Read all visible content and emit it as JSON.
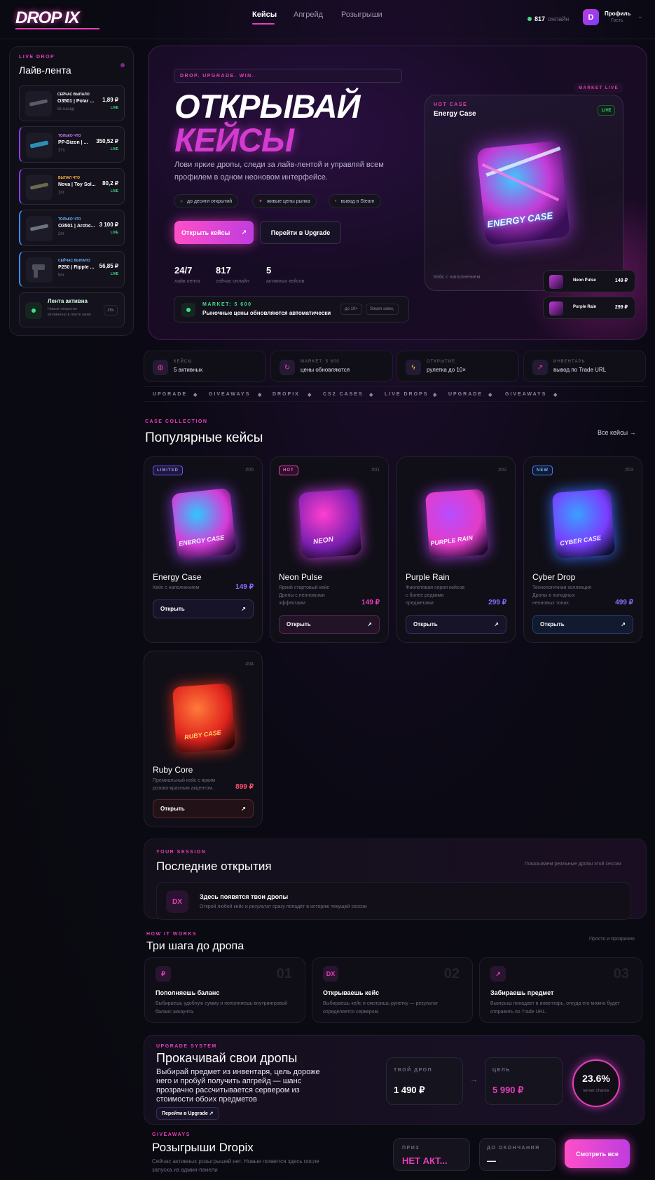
{
  "header": {
    "logo": "DROP IX",
    "nav": [
      "Кейсы",
      "Апгрейд",
      "Розыгрыши"
    ],
    "online_count": "817",
    "online_label": "онлайн",
    "avatar_letter": "D",
    "profile_name": "Профиль",
    "profile_role": "Гость"
  },
  "sidebar": {
    "kicker": "LIVE DROP",
    "title": "Лайв-лента",
    "items": [
      {
        "tag": "СЕЙЧАС ВЫПАЛО",
        "name": "Ο3501 | Polar ...",
        "time": "8s назад",
        "price": "1,89 ₽",
        "live": "LIVE",
        "tag_color": "#ffffff"
      },
      {
        "tag": "ТОЛЬКО ЧТО",
        "name": "PP-Bizon | ...",
        "time": "37s",
        "price": "350,52 ₽",
        "live": "LIVE",
        "tag_color": "#c77dff"
      },
      {
        "tag": "ВЫПАЛ ЧТО",
        "name": "Nova | Toy Sol...",
        "time": "1m",
        "price": "80,2 ₽",
        "live": "LIVE",
        "tag_color": "#ffb347"
      },
      {
        "tag": "ТОЛЬКО ЧТО",
        "name": "Ο3501 | Arctic...",
        "time": "2m",
        "price": "3 100 ₽",
        "live": "LIVE",
        "tag_color": "#6ab8ff"
      },
      {
        "tag": "СЕЙЧАС ВЫПАЛО",
        "name": "P250 | Ripple ...",
        "time": "5m",
        "price": "56,85 ₽",
        "live": "LIVE",
        "tag_color": "#6ab8ff"
      }
    ],
    "active": {
      "title": "Лента активна",
      "desc": "Новые открытия мгновенно в ленте ниже",
      "badge": "15s"
    }
  },
  "hero": {
    "tag": "DROP. UPGRADE. WIN.",
    "title1": "ОТКРЫВАЙ",
    "title2": "КЕЙСЫ",
    "desc": "Лови яркие дропы, следи за лайв-лентой и управляй всем профилем в одном неоновом интерфейсе.",
    "chips": [
      "до десяти открытий",
      "живые цены рынка",
      "вывод в Steam"
    ],
    "btn_primary": "Открыть кейсы",
    "btn_secondary": "Перейти в Upgrade",
    "stats": [
      {
        "value": "24/7",
        "label": "лайв лента"
      },
      {
        "value": "817",
        "label": "сейчас онлайн"
      },
      {
        "value": "5",
        "label": "активных кейсов"
      }
    ],
    "market": {
      "kicker": "MARKET: 5 600",
      "text": "Рыночные цены обновляются автоматически",
      "chip1": "до 10×",
      "chip2": "Steam sales,"
    },
    "market_live": "MARKET LIVE",
    "hot": {
      "kicker": "HOT CASE",
      "name": "Energy Case",
      "badge": "LIVE",
      "art": "ENERGY CASE",
      "caption": "Кейс с наполнением"
    },
    "mini": [
      {
        "name": "Neon Pulse",
        "price": "149 ₽"
      },
      {
        "name": "Purple Rain",
        "price": "299 ₽"
      }
    ]
  },
  "features": [
    {
      "icon": "case-icon",
      "kicker": "КЕЙСЫ",
      "text": "5 активных"
    },
    {
      "icon": "refresh-icon",
      "kicker": "MARKET: 5 600",
      "text": "цены обновляются"
    },
    {
      "icon": "bolt-icon",
      "kicker": "ОТКРЫТИЕ",
      "text": "рулетка до 10×"
    },
    {
      "icon": "arrow-icon",
      "kicker": "ИНВЕНТАРЬ",
      "text": "вывод по Trade URL"
    }
  ],
  "marquee": [
    "UPGRADE",
    "GIVEAWAYS",
    "DROPIX",
    "CS2 CASES",
    "LIVE DROPS",
    "UPGRADE",
    "GIVEAWAYS"
  ],
  "collection": {
    "kicker": "CASE COLLECTION",
    "title": "Популярные кейсы",
    "all_link": "Все кейсы",
    "cases": [
      {
        "badge": "LIMITED",
        "num": "#05",
        "name": "Energy Case",
        "desc": "Кейс с наполнением",
        "price": "149 ₽",
        "open": "Открыть",
        "art": "ENERGY CASE",
        "c1": "#2ec8ff",
        "c2": "#d63bd8"
      },
      {
        "badge": "HOT",
        "num": "#01",
        "name": "Neon Pulse",
        "desc": "Яркий стартовый кейс Дропы с неоновыми эффектами",
        "price": "149 ₽",
        "open": "Открыть",
        "art": "NEON",
        "c1": "#ff3fd0",
        "c2": "#7a1fb0"
      },
      {
        "badge": "",
        "num": "#02",
        "name": "Purple Rain",
        "desc": "Фиолетовая серия кейсов с более редкими предметами",
        "price": "299 ₽",
        "open": "Открыть",
        "art": "PURPLE RAIN",
        "c1": "#b84dff",
        "c2": "#e23bc8"
      },
      {
        "badge": "NEW",
        "num": "#03",
        "name": "Cyber Drop",
        "desc": "Технологичная коллекция Дропы в холодных неоновых тонах.",
        "price": "499 ₽",
        "open": "Открыть",
        "art": "CYBER CASE",
        "c1": "#3aa0ff",
        "c2": "#7a3dff"
      },
      {
        "badge": "",
        "num": "#04",
        "name": "Ruby Core",
        "desc": "Премиальный кейс с ярким розово-красным акцентом.",
        "price": "899 ₽",
        "open": "Открыть",
        "art": "RUBY CASE",
        "c1": "#ff3a2a",
        "c2": "#ffb03a"
      }
    ]
  },
  "session": {
    "kicker": "YOUR SESSION",
    "title": "Последние открытия",
    "note": "Показываем реальные дропы этой сессии",
    "icon": "DX",
    "empty_title": "Здесь появятся твои дропы",
    "empty_desc": "Открой любой кейс и результат сразу попадёт в историю текущей сессии"
  },
  "how": {
    "kicker": "HOW IT WORKS",
    "title": "Три шага до дропа",
    "note": "Просто и прозрачно",
    "steps": [
      {
        "icon": "₽",
        "num": "01",
        "title": "Пополняешь баланс",
        "desc": "Выбираешь удобную сумму и пополняешь внутриигровой баланс аккаунта."
      },
      {
        "icon": "DX",
        "num": "02",
        "title": "Открываешь кейс",
        "desc": "Выбираешь кейс и смотришь рулетку — результат определяется сервером."
      },
      {
        "icon": "↗",
        "num": "03",
        "title": "Забираешь предмет",
        "desc": "Выигрыш попадает в инвентарь, откуда его можно будет отправить по Trade URL."
      }
    ]
  },
  "upgrade": {
    "kicker": "UPGRADE SYSTEM",
    "title": "Прокачивай свои дропы",
    "desc": "Выбирай предмет из инвентаря, цель дороже него и пробуй получить апгрейд — шанс прозрачно рассчитывается сервером из стоимости обоих предметов",
    "btn": "Перейти в Upgrade ↗",
    "your_label": "ТВОЙ ДРОП",
    "your_value": "1 490 ₽",
    "target_label": "ЦЕЛЬ",
    "target_value": "5 990 ₽",
    "chance": "23.6%",
    "chance_label": "server chance"
  },
  "giveaways": {
    "kicker": "GIVEAWAYS",
    "title": "Розыгрыши Dropix",
    "desc": "Сейчас активных розыгрышей нет. Новые появятся здесь после запуска из админ-панели",
    "prize_label": "ПРИЗ",
    "prize_value": "НЕТ АКТ...",
    "end_label": "ДО ОКОНЧАНИЯ",
    "end_value": "—",
    "btn": "Смотреть все"
  }
}
